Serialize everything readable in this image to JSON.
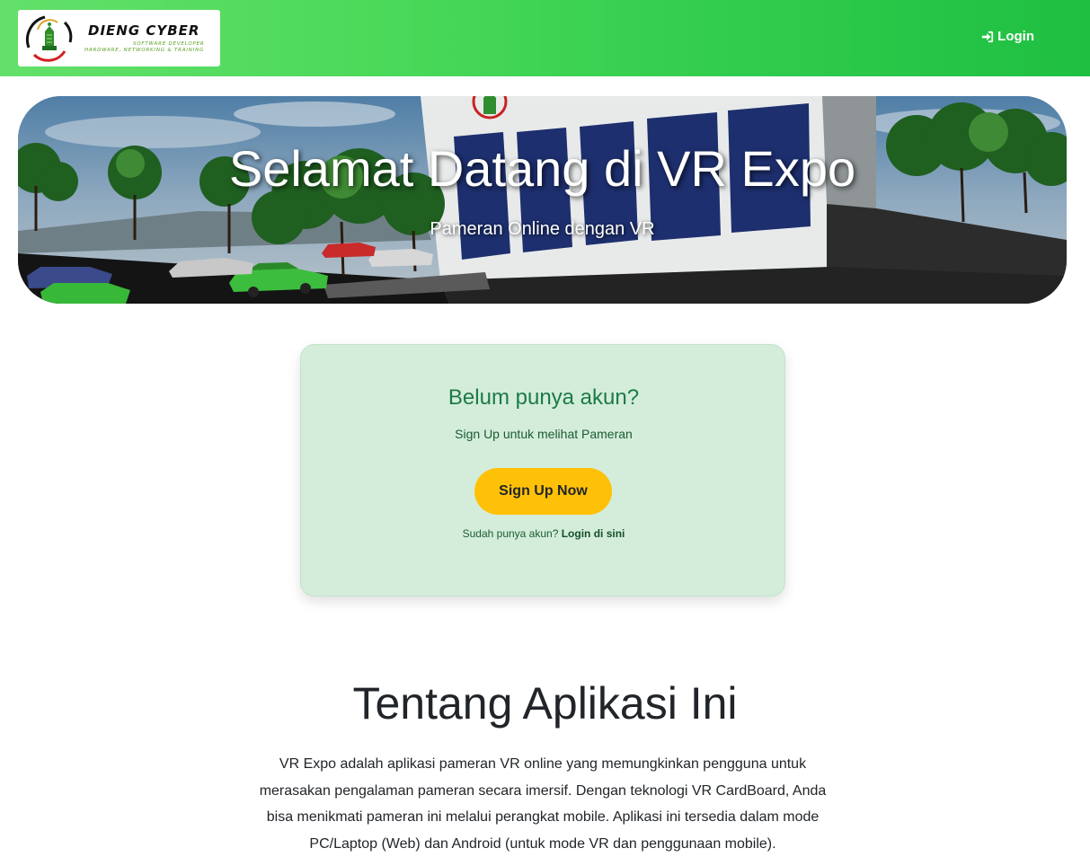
{
  "navbar": {
    "logo": {
      "title": "DIENG CYBER",
      "line1": "SOFTWARE DEVELOPER",
      "line2": "HARDWARE, NETWORKING & TRAINING"
    },
    "login_label": "Login",
    "login_icon": "sign-in-icon",
    "gradient_start": "#63e06a",
    "gradient_end": "#1fbf42"
  },
  "hero": {
    "title": "Selamat Datang di VR Expo",
    "subtitle": "Pameran Online dengan VR"
  },
  "signup_card": {
    "title": "Belum punya akun?",
    "subtitle": "Sign Up untuk melihat Pameran",
    "button_label": "Sign Up Now",
    "login_prompt": "Sudah punya akun?",
    "login_link": "Login di sini",
    "background": "#d4eddb",
    "button_color": "#ffc107"
  },
  "about": {
    "title": "Tentang Aplikasi Ini",
    "text": "VR Expo adalah aplikasi pameran VR online yang memungkinkan pengguna untuk merasakan pengalaman pameran secara imersif. Dengan teknologi VR CardBoard, Anda bisa menikmati pameran ini melalui perangkat mobile. Aplikasi ini tersedia dalam mode PC/Laptop (Web) dan Android (untuk mode VR dan penggunaan mobile)."
  }
}
